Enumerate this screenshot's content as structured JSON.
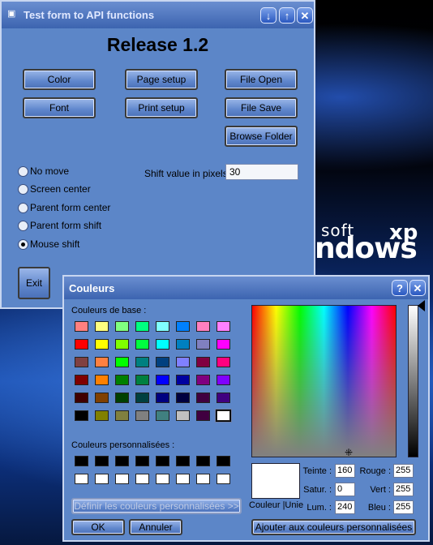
{
  "form": {
    "title": "Test form to API functions",
    "title_buttons": [
      "↓",
      "↑",
      "✕"
    ],
    "heading": "Release 1.2",
    "buttons": {
      "color": "Color",
      "page_setup": "Page setup",
      "file_open": "File Open",
      "font": "Font",
      "print_setup": "Print setup",
      "file_save": "File Save",
      "browse_folder": "Browse Folder",
      "exit": "Exit"
    },
    "radios": [
      {
        "label": "No move",
        "selected": false
      },
      {
        "label": "Screen center",
        "selected": false
      },
      {
        "label": "Parent form center",
        "selected": false
      },
      {
        "label": "Parent form shift",
        "selected": false
      },
      {
        "label": "Mouse shift",
        "selected": true
      }
    ],
    "shift_label": "Shift value in pixels",
    "shift_value": "30"
  },
  "dialog": {
    "title": "Couleurs",
    "help": "?",
    "close": "✕",
    "basic_label": "Couleurs de base :",
    "custom_label": "Couleurs personnalisées :",
    "define_button": "Définir les couleurs personnalisées >>",
    "ok": "OK",
    "cancel": "Annuler",
    "add_button": "Ajouter aux couleurs personnalisées",
    "solid_label": "Couleur |Unie",
    "fields": {
      "hue_label": "Teinte :",
      "hue": "160",
      "sat_label": "Satur. :",
      "sat": "0",
      "lum_label": "Lum. :",
      "lum": "240",
      "red_label": "Rouge :",
      "red": "255",
      "green_label": "Vert :",
      "green": "255",
      "blue_label": "Bleu :",
      "blue": "255"
    },
    "basic_colors": [
      [
        "#ff8080",
        "#ffff80",
        "#80ff80",
        "#00ff80",
        "#80ffff",
        "#0080ff",
        "#ff80c0",
        "#ff80ff"
      ],
      [
        "#ff0000",
        "#ffff00",
        "#80ff00",
        "#00ff40",
        "#00ffff",
        "#0080c0",
        "#8080c0",
        "#ff00ff"
      ],
      [
        "#804040",
        "#ff8040",
        "#00ff00",
        "#008080",
        "#004080",
        "#8080ff",
        "#800040",
        "#ff0080"
      ],
      [
        "#800000",
        "#ff8000",
        "#008000",
        "#008040",
        "#0000ff",
        "#0000a0",
        "#800080",
        "#8000ff"
      ],
      [
        "#400000",
        "#804000",
        "#004000",
        "#004040",
        "#000080",
        "#000040",
        "#400040",
        "#400080"
      ],
      [
        "#000000",
        "#808000",
        "#808040",
        "#808080",
        "#408080",
        "#c0c0c0",
        "#400040",
        "#ffffff"
      ]
    ],
    "custom_colors": [
      [
        "#000000",
        "#000000",
        "#000000",
        "#000000",
        "#000000",
        "#000000",
        "#000000",
        "#000000"
      ],
      [
        "#ffffff",
        "#ffffff",
        "#ffffff",
        "#ffffff",
        "#ffffff",
        "#ffffff",
        "#ffffff",
        "#ffffff"
      ]
    ]
  },
  "desktop": {
    "logo_lines": [
      "soft",
      "ndows",
      "xp"
    ],
    "bottom_text": "OK"
  }
}
